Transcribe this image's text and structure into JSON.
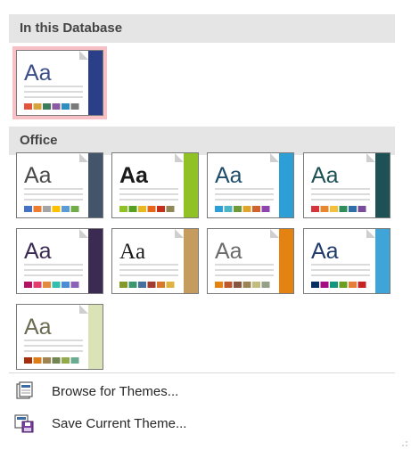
{
  "sections": {
    "database_title": "In this Database",
    "office_title": "Office"
  },
  "themes": {
    "database": [
      {
        "name": "current",
        "sample": "Aa",
        "serif": false,
        "title_color": "#3b4e87",
        "accent": "#2a3f88",
        "border": "#2a3f88",
        "swatches": [
          "#e2543b",
          "#d5a43c",
          "#3e7b5a",
          "#8b5aa3",
          "#2e8ec0",
          "#7a7a7a"
        ]
      }
    ],
    "office": [
      {
        "name": "office-theme",
        "sample": "Aa",
        "serif": false,
        "title_color": "#4a4a4a",
        "accent": "#44546a",
        "border": "#44546a",
        "swatches": [
          "#4472c4",
          "#ed7d31",
          "#a5a5a5",
          "#ffc000",
          "#5b9bd5",
          "#70ad47"
        ]
      },
      {
        "name": "facet",
        "sample": "Aa",
        "serif": false,
        "bold": true,
        "title_color": "#1a1a1a",
        "accent": "#90c226",
        "border": "#548720",
        "swatches": [
          "#90c226",
          "#54a021",
          "#e6b91e",
          "#e76618",
          "#c42f1a",
          "#918655"
        ]
      },
      {
        "name": "ion",
        "sample": "Aa",
        "serif": false,
        "title_color": "#1f4e6b",
        "accent": "#2e9ed6",
        "border": "#2e9ed6",
        "swatches": [
          "#2e9ed6",
          "#4ab5c4",
          "#6e9b37",
          "#e0a52a",
          "#d0622e",
          "#8e44ad"
        ]
      },
      {
        "name": "integral",
        "sample": "Aa",
        "serif": false,
        "title_color": "#1e5155",
        "accent": "#1e5155",
        "border": "#1e5155",
        "swatches": [
          "#d4343a",
          "#e6892e",
          "#f2c03a",
          "#2d8e5c",
          "#2e6fa7",
          "#7a4b9b"
        ]
      },
      {
        "name": "ion-boardroom",
        "sample": "Aa",
        "serif": false,
        "title_color": "#3b2a52",
        "accent": "#3b2a52",
        "border": "#3b2a52",
        "swatches": [
          "#b31166",
          "#e33d6f",
          "#e28b3e",
          "#33bfae",
          "#4a8dd6",
          "#8a62b6"
        ]
      },
      {
        "name": "organic",
        "sample": "Aa",
        "serif": true,
        "title_color": "#1a1a1a",
        "accent": "#c69b5e",
        "border": "#8b6a3a",
        "swatches": [
          "#83992a",
          "#3c9770",
          "#44709d",
          "#a23c33",
          "#d97828",
          "#deb340"
        ]
      },
      {
        "name": "retrospect",
        "sample": "Aa",
        "serif": false,
        "title_color": "#6b6b6b",
        "accent": "#e48312",
        "border": "#bd582c",
        "swatches": [
          "#e48312",
          "#bd582c",
          "#865640",
          "#9b8357",
          "#c2bc80",
          "#94a088"
        ]
      },
      {
        "name": "slice",
        "sample": "Aa",
        "serif": false,
        "title_color": "#1f3c6b",
        "accent": "#3fa5d8",
        "border": "#1f3c6b",
        "swatches": [
          "#052f61",
          "#a50e82",
          "#14967c",
          "#6a9e1f",
          "#e87d37",
          "#c62324"
        ]
      },
      {
        "name": "wisp",
        "sample": "Aa",
        "serif": false,
        "title_color": "#6b6b52",
        "accent": "#d9e3b5",
        "border": "#a5a57a",
        "swatches": [
          "#a53010",
          "#de7e18",
          "#9f8351",
          "#728653",
          "#92aa4c",
          "#6aac91"
        ]
      }
    ]
  },
  "commands": {
    "browse_label": "Browse for Themes...",
    "save_label": "Save Current Theme..."
  },
  "icons": {
    "browse": "browse-themes-icon",
    "save": "save-theme-icon"
  }
}
